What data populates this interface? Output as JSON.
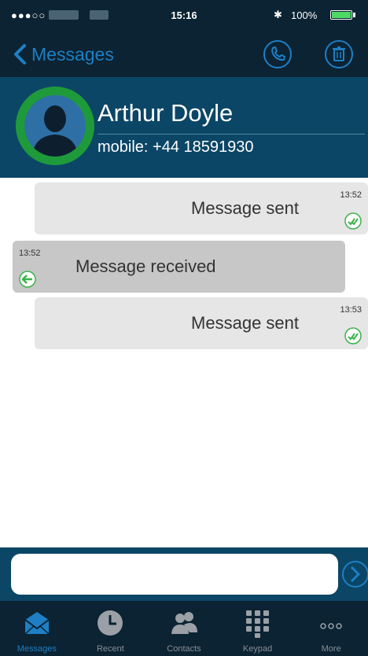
{
  "status_bar": {
    "signal": "●●●○○",
    "time": "15:16",
    "battery": "100%"
  },
  "nav": {
    "back_label": "Messages"
  },
  "contact": {
    "name": "Arthur Doyle",
    "number": "mobile: +44 18591930"
  },
  "messages": [
    {
      "direction": "sent",
      "text": "Message sent",
      "time": "13:52"
    },
    {
      "direction": "received",
      "text": "Message received",
      "time": "13:52"
    },
    {
      "direction": "sent",
      "text": "Message sent",
      "time": "13:53"
    }
  ],
  "composer": {
    "value": "",
    "placeholder": ""
  },
  "tabs": [
    {
      "label": "Messages",
      "icon": "messages-icon",
      "active": true
    },
    {
      "label": "Recent",
      "icon": "clock-icon",
      "active": false
    },
    {
      "label": "Contacts",
      "icon": "contacts-icon",
      "active": false
    },
    {
      "label": "Keypad",
      "icon": "keypad-icon",
      "active": false
    },
    {
      "label": "More",
      "icon": "more-icon",
      "active": false
    }
  ],
  "colors": {
    "bar_dark": "#0b2333",
    "header_blue": "#0b4666",
    "accent": "#1e7fc4",
    "avatar_ring": "#1f9a3a",
    "status_green": "#3bb34a"
  }
}
